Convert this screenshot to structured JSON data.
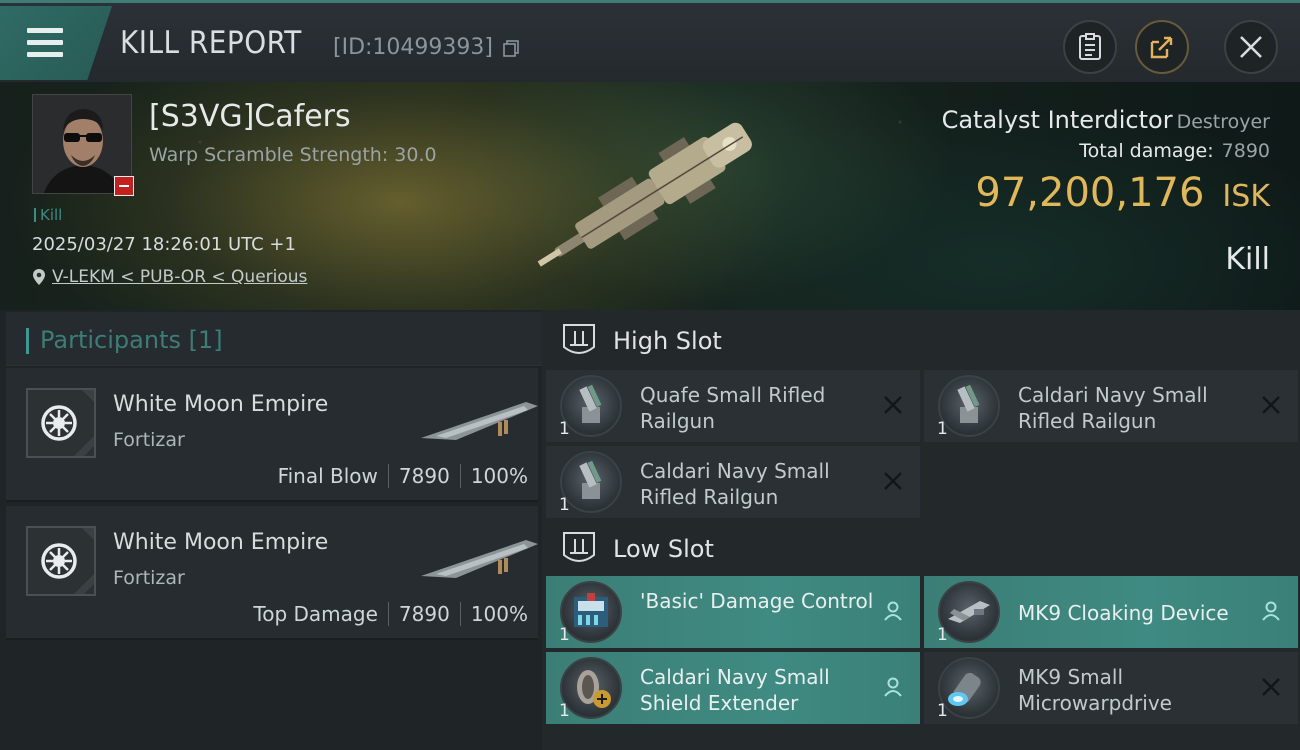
{
  "header": {
    "title": "KILL REPORT",
    "report_id": "[ID:10499393]"
  },
  "victim": {
    "name": "[S3VG]Cafers",
    "warp_scramble": "Warp Scramble Strength: 30.0",
    "kill_tag": "Kill",
    "timestamp": "2025/03/27 18:26:01 UTC +1",
    "location": "V-LEKM < PUB-OR < Querious"
  },
  "ship": {
    "name": "Catalyst Interdictor",
    "class": "Destroyer",
    "total_damage_label": "Total damage:",
    "total_damage": "7890",
    "isk_value": "97,200,176",
    "isk_unit": "ISK",
    "result": "Kill"
  },
  "participants": {
    "title": "Participants [1]",
    "rows": [
      {
        "name": "White Moon Empire",
        "ship": "Fortizar",
        "role": "Final Blow",
        "damage": "7890",
        "percent": "100%"
      },
      {
        "name": "White Moon Empire",
        "ship": "Fortizar",
        "role": "Top Damage",
        "damage": "7890",
        "percent": "100%"
      }
    ]
  },
  "slots": {
    "high": {
      "label": "High Slot",
      "modules": [
        {
          "name": "Quafe Small Rifled Railgun",
          "qty": "1",
          "status": "destroyed"
        },
        {
          "name": "Caldari Navy Small Rifled Railgun",
          "qty": "1",
          "status": "destroyed"
        },
        {
          "name": "Caldari Navy Small Rifled Railgun",
          "qty": "1",
          "status": "destroyed"
        }
      ]
    },
    "low": {
      "label": "Low Slot",
      "modules": [
        {
          "name": "'Basic' Damage Control",
          "qty": "1",
          "status": "dropped"
        },
        {
          "name": "MK9 Cloaking Device",
          "qty": "1",
          "status": "dropped"
        },
        {
          "name": "Caldari Navy Small Shield Extender",
          "qty": "1",
          "status": "dropped"
        },
        {
          "name": "MK9 Small Microwarpdrive",
          "qty": "1",
          "status": "destroyed"
        }
      ]
    }
  },
  "icons": {
    "menu": "menu-icon",
    "copy": "copy-icon",
    "clipboard": "clipboard-icon",
    "share": "share-icon",
    "close": "close-icon",
    "location": "location-pin-icon",
    "slot": "slot-icon",
    "dropped": "person-icon",
    "destroyed": "x-icon"
  },
  "colors": {
    "accent": "#3d8b82",
    "isk": "#e0b85a",
    "highlight_row": "#3f8a82",
    "victim_badge": "#c42020"
  }
}
